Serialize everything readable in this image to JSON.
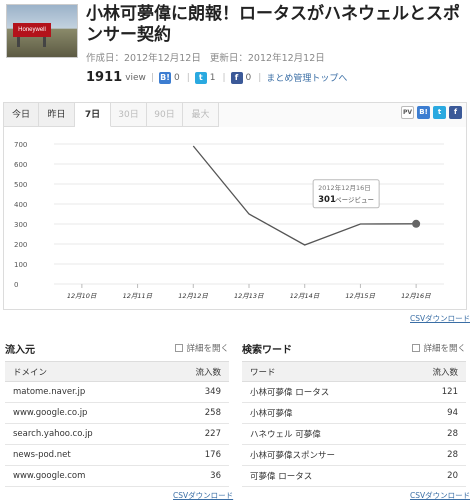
{
  "article": {
    "title": "小林可夢偉に朗報！ロータスがハネウェルとスポンサー契約",
    "thumb_sign": "Honeywell",
    "created": "作成日：2012年12月12日",
    "updated": "更新日：2012年12月12日",
    "views": "1911",
    "views_unit": "view",
    "hatena_count": "0",
    "twitter_count": "1",
    "facebook_count": "0",
    "manage_link": "まとめ管理トップへ"
  },
  "tabs": [
    {
      "label": "今日",
      "state": "normal"
    },
    {
      "label": "昨日",
      "state": "normal"
    },
    {
      "label": "7日",
      "state": "active"
    },
    {
      "label": "30日",
      "state": "disabled"
    },
    {
      "label": "90日",
      "state": "disabled"
    },
    {
      "label": "最大",
      "state": "disabled"
    }
  ],
  "share": {
    "pv": "PV",
    "hb": "B!",
    "tw": "t",
    "fb": "f"
  },
  "chart_data": {
    "type": "line",
    "x": [
      "12月10日",
      "12月11日",
      "12月12日",
      "12月13日",
      "12月14日",
      "12月15日",
      "12月16日"
    ],
    "y": [
      null,
      null,
      690,
      350,
      195,
      300,
      301
    ],
    "ylim": [
      0,
      700
    ],
    "yticks": [
      0,
      100,
      200,
      300,
      400,
      500,
      600,
      700
    ],
    "tooltip": {
      "date": "2012年12月16日",
      "value": "301",
      "unit": "ページビュー"
    },
    "line_color": "#555555"
  },
  "csv_label": "CSVダウンロード",
  "referrers": {
    "title": "流入元",
    "detail": "詳細を開く",
    "headers": [
      "ドメイン",
      "流入数"
    ],
    "rows": [
      [
        "matome.naver.jp",
        "349"
      ],
      [
        "www.google.co.jp",
        "258"
      ],
      [
        "search.yahoo.co.jp",
        "227"
      ],
      [
        "news-pod.net",
        "176"
      ],
      [
        "www.google.com",
        "36"
      ]
    ]
  },
  "keywords": {
    "title": "検索ワード",
    "detail": "詳細を開く",
    "headers": [
      "ワード",
      "流入数"
    ],
    "rows": [
      [
        "小林可夢偉 ロータス",
        "121"
      ],
      [
        "小林可夢偉",
        "94"
      ],
      [
        "ハネウェル 可夢偉",
        "28"
      ],
      [
        "小林可夢偉スポンサー",
        "28"
      ],
      [
        "可夢偉 ロータス",
        "20"
      ]
    ]
  }
}
